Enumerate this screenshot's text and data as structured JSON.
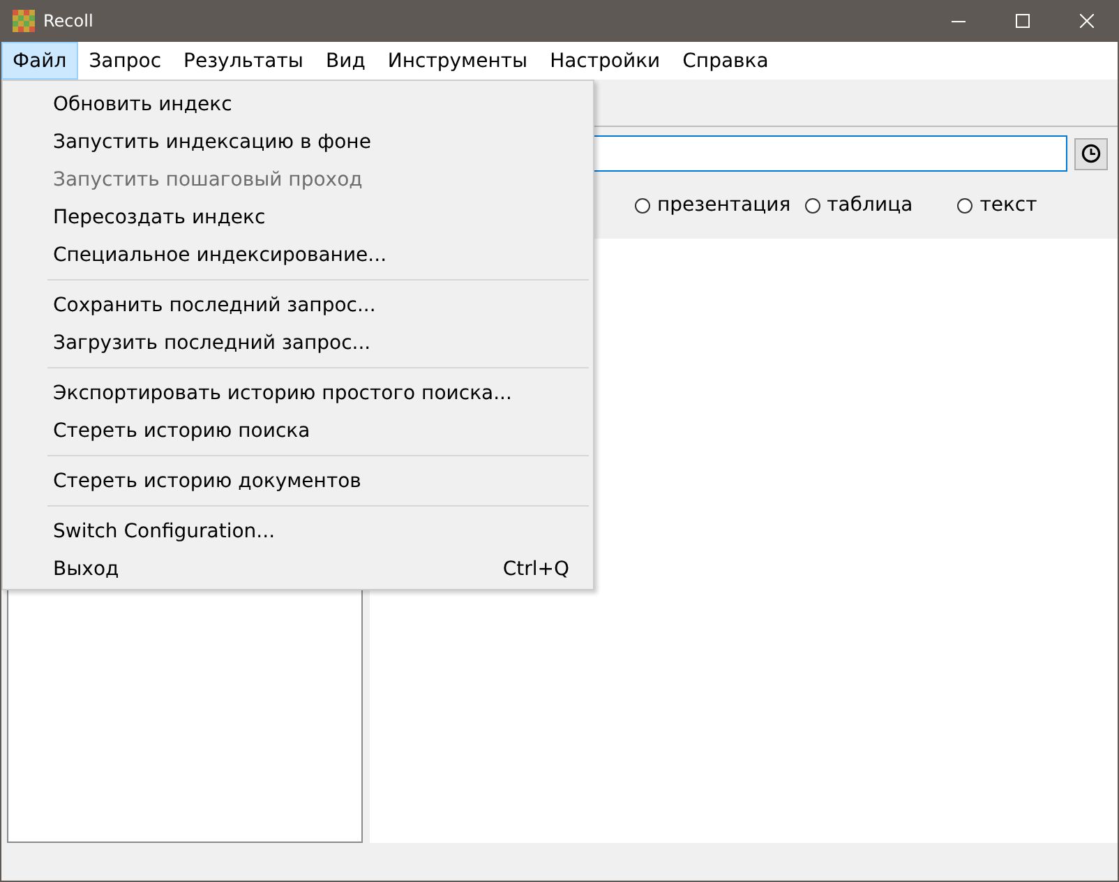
{
  "window": {
    "title": "Recoll"
  },
  "menubar": [
    {
      "label": "Файл",
      "selected": true
    },
    {
      "label": "Запрос",
      "selected": false
    },
    {
      "label": "Результаты",
      "selected": false
    },
    {
      "label": "Вид",
      "selected": false
    },
    {
      "label": "Инструменты",
      "selected": false
    },
    {
      "label": "Настройки",
      "selected": false
    },
    {
      "label": "Справка",
      "selected": false
    }
  ],
  "file_menu": [
    {
      "kind": "item",
      "label": "Обновить индекс",
      "disabled": false
    },
    {
      "kind": "item",
      "label": "Запустить индексацию в фоне",
      "disabled": false
    },
    {
      "kind": "item",
      "label": "Запустить пошаговый проход",
      "disabled": true
    },
    {
      "kind": "item",
      "label": "Пересоздать индекс",
      "disabled": false
    },
    {
      "kind": "item",
      "label": "Специальное индексирование...",
      "disabled": false
    },
    {
      "kind": "separator"
    },
    {
      "kind": "item",
      "label": "Сохранить последний запрос...",
      "disabled": false
    },
    {
      "kind": "item",
      "label": "Загрузить последний запрос...",
      "disabled": false
    },
    {
      "kind": "separator"
    },
    {
      "kind": "item",
      "label": "Экспортировать историю простого поиска...",
      "disabled": false
    },
    {
      "kind": "item",
      "label": "Стереть историю поиска",
      "disabled": false
    },
    {
      "kind": "separator"
    },
    {
      "kind": "item",
      "label": "Стереть историю документов",
      "disabled": false
    },
    {
      "kind": "separator"
    },
    {
      "kind": "item",
      "label": "Switch Configuration...",
      "disabled": false
    },
    {
      "kind": "item",
      "label": "Выход",
      "shortcut": "Ctrl+Q",
      "disabled": false
    }
  ],
  "result_format": [
    {
      "label": "презентация",
      "selected": false
    },
    {
      "label": "таблица",
      "selected": false
    },
    {
      "label": "текст",
      "selected": false
    }
  ]
}
